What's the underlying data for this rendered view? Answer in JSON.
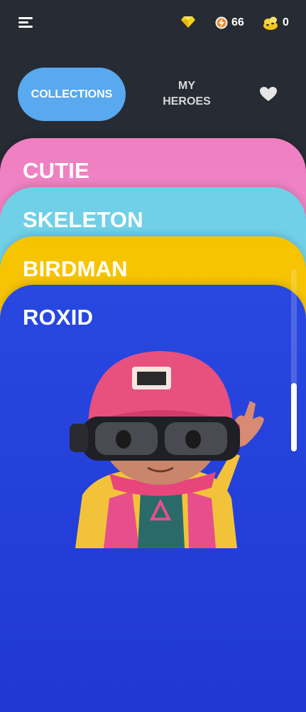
{
  "topbar": {
    "menu_icon": "hamburger-menu-icon",
    "gems_icon": "diamond-icon",
    "energy_icon": "energy-bolt-icon",
    "energy_value": "66",
    "coins_icon": "coin-pile-icon",
    "coins_value": "0"
  },
  "tabs": {
    "collections": "COLLECTIONS",
    "my_heroes_line1": "MY",
    "my_heroes_line2": "HEROES",
    "favorites_icon": "heart-icon",
    "active": "collections"
  },
  "cards": [
    {
      "title": "CUTIE",
      "color": "#f08cc6"
    },
    {
      "title": "SKELETON",
      "color": "#74d3ea"
    },
    {
      "title": "BIRDMAN",
      "color": "#f7c800"
    },
    {
      "title": "ROXID",
      "color": "#2440d8"
    }
  ],
  "colors": {
    "background": "#272b33",
    "accent": "#58a9ef",
    "gem": "#f5d21a",
    "energy": "#f08a2e"
  }
}
